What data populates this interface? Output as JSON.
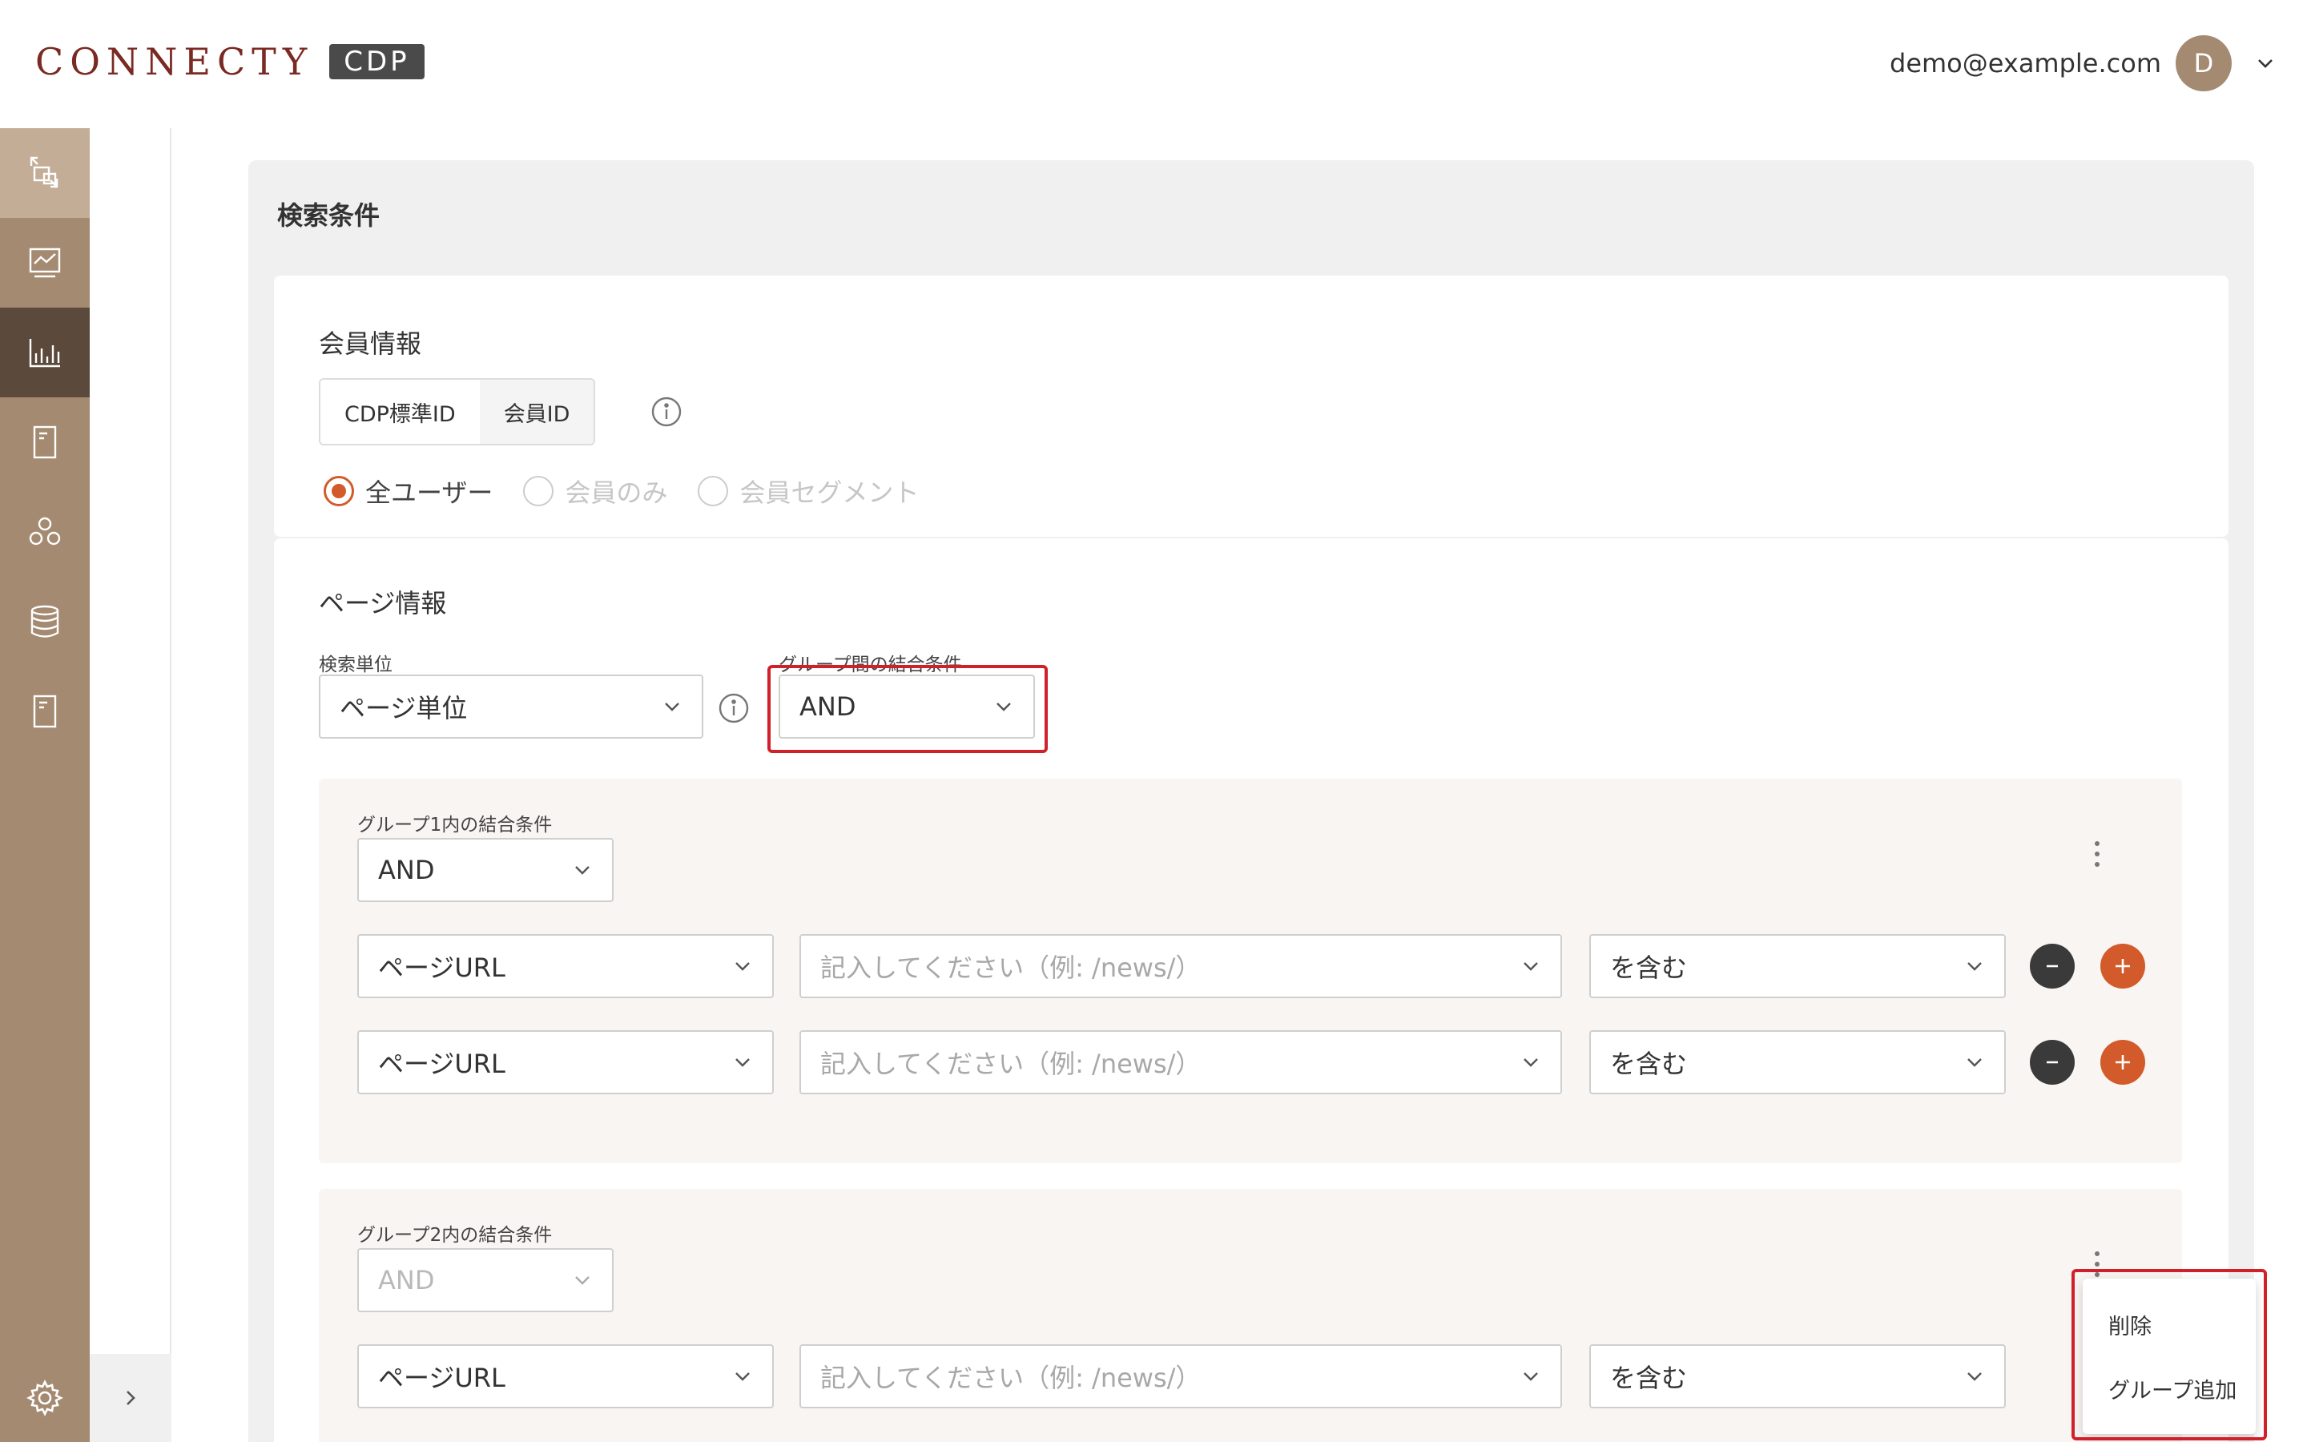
{
  "header": {
    "logo_text": "CONNECTY",
    "logo_badge": "CDP",
    "user_email": "demo@example.com",
    "avatar_initial": "D"
  },
  "sidebar": {
    "items": [
      {
        "icon": "transfer-icon",
        "state": "active-light"
      },
      {
        "icon": "dashboard-chart-icon",
        "state": "normal"
      },
      {
        "icon": "bar-chart-icon",
        "state": "active-dark"
      },
      {
        "icon": "document-icon",
        "state": "normal"
      },
      {
        "icon": "segment-icon",
        "state": "normal"
      },
      {
        "icon": "database-icon",
        "state": "normal"
      },
      {
        "icon": "report-icon",
        "state": "normal"
      }
    ],
    "settings_icon": "gear-icon",
    "expand_icon": "chevron-right-icon"
  },
  "panel": {
    "title": "検索条件"
  },
  "member": {
    "section_label": "会員情報",
    "id_types": [
      "CDP標準ID",
      "会員ID"
    ],
    "radios": [
      {
        "label": "全ユーザー",
        "checked": true,
        "enabled": true
      },
      {
        "label": "会員のみ",
        "checked": false,
        "enabled": false
      },
      {
        "label": "会員セグメント",
        "checked": false,
        "enabled": false
      }
    ]
  },
  "page": {
    "section_label": "ページ情報",
    "search_unit_label": "検索単位",
    "search_unit_value": "ページ単位",
    "between_groups_label": "グループ間の結合条件",
    "between_groups_value": "AND",
    "groups": [
      {
        "label": "グループ1内の結合条件",
        "value": "AND",
        "disabled": false,
        "rows": [
          {
            "field": "ページURL",
            "placeholder": "記入してください（例: /news/）",
            "operator": "を含む"
          },
          {
            "field": "ページURL",
            "placeholder": "記入してください（例: /news/）",
            "operator": "を含む"
          }
        ]
      },
      {
        "label": "グループ2内の結合条件",
        "value": "AND",
        "disabled": true,
        "rows": [
          {
            "field": "ページURL",
            "placeholder": "記入してください（例: /news/）",
            "operator": "を含む"
          }
        ]
      }
    ]
  },
  "context_menu": {
    "items": [
      "削除",
      "グループ追加"
    ]
  },
  "colors": {
    "sidebar": "#a58a72",
    "accent": "#d35a2a",
    "highlight": "#d0202a",
    "logo": "#7a2a22"
  }
}
